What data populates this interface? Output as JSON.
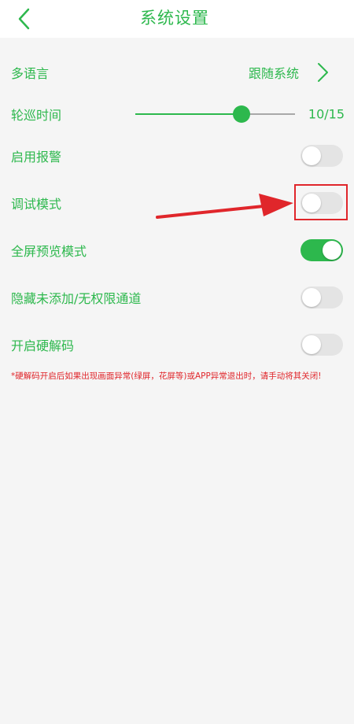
{
  "header": {
    "title": "系统设置",
    "back_icon": "chevron-left-icon"
  },
  "settings": {
    "language": {
      "label": "多语言",
      "value": "跟随系统",
      "icon": "chevron-right-icon"
    },
    "patrol_time": {
      "label": "轮巡时间",
      "value": 10,
      "max": 15,
      "display": "10/15"
    },
    "enable_alarm": {
      "label": "启用报警",
      "on": false
    },
    "debug_mode": {
      "label": "调试模式",
      "on": false
    },
    "fullscreen_preview": {
      "label": "全屏预览模式",
      "on": true
    },
    "hide_channels": {
      "label": "隐藏未添加/无权限通道",
      "on": false
    },
    "hardware_decode": {
      "label": "开启硬解码",
      "on": false
    }
  },
  "note": "*硬解码开启后如果出现画面异常(绿屏，花屏等)或APP异常退出时，请手动将其关闭!",
  "colors": {
    "accent": "#2db84d",
    "warning": "#e0262b",
    "background": "#f5f5f5",
    "toggle_off": "#e4e4e4"
  }
}
